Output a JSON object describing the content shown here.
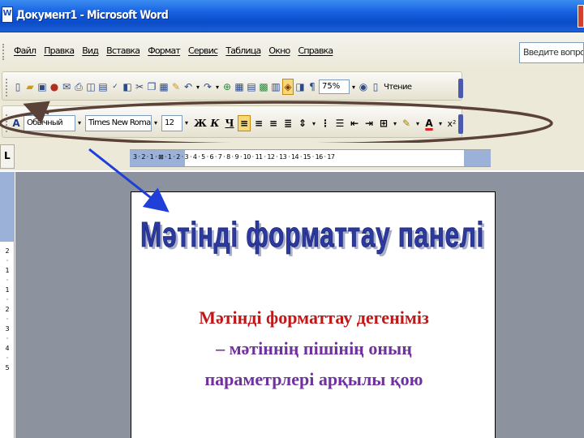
{
  "window": {
    "title": "Документ1 - Microsoft Word"
  },
  "menu": {
    "items": [
      "Файл",
      "Правка",
      "Вид",
      "Вставка",
      "Формат",
      "Сервис",
      "Таблица",
      "Окно",
      "Справка"
    ],
    "help_placeholder": "Введите вопрос"
  },
  "standard_toolbar": {
    "zoom": "75%",
    "read_label": "Чтение"
  },
  "formatting_toolbar": {
    "style": "Обычный",
    "font": "Times New Roman",
    "size": "12",
    "bold": "Ж",
    "italic": "К",
    "underline": "Ч",
    "font_color_label": "A",
    "superscript": "x²"
  },
  "ruler": {
    "corner_label": "L",
    "numbers": "3 · 2 · 1 · ⊠ · 1 · 2 · 3 · 4 · 5 · 6 · 7 · 8 · 9 · 10 · 11 · 12 · 13 · 14 · 15 · 16 · 17",
    "vertical_numbers": "2 · 1 · 1 · 2 · 3 · 4 · 5"
  },
  "document": {
    "heading": "Мәтінді форматтау панелі",
    "para_line1": "Мәтінді форматтау дегеніміз",
    "para_line2": "– мәтіннің пішінің оның",
    "para_line3": "параметрлері арқылы қою"
  },
  "colors": {
    "heading_fill": "#2c3aa0",
    "heading_shadow": "#aab0cc",
    "para_red": "#c01818",
    "para_violet": "#7030a0",
    "ellipse_stroke": "#5a4238",
    "arrow_blue": "#1f3fd8"
  }
}
